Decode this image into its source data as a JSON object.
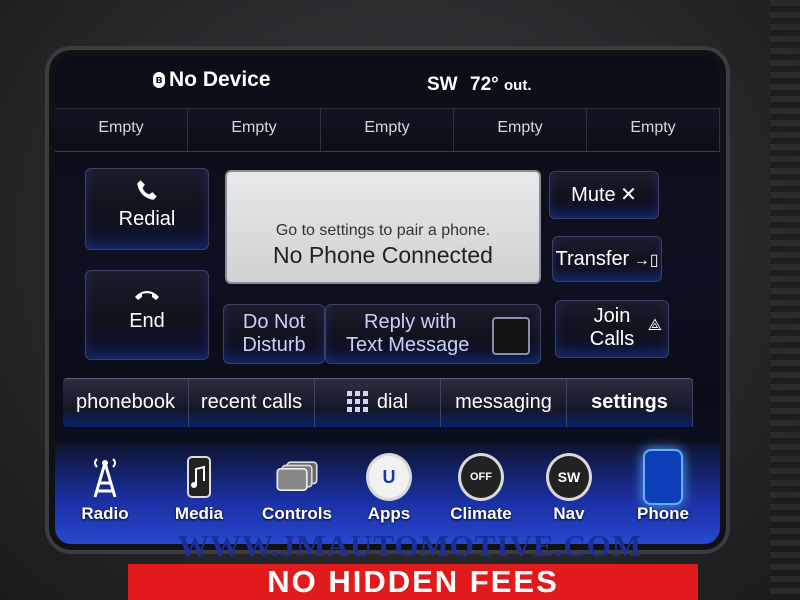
{
  "status": {
    "device": "No Device",
    "compass": "SW",
    "temp": "72°",
    "temp_suffix": "out."
  },
  "favorites": [
    "Empty",
    "Empty",
    "Empty",
    "Empty",
    "Empty"
  ],
  "phone": {
    "redial_label": "Redial",
    "end_label": "End",
    "mute_label": "Mute",
    "transfer_label": "Transfer",
    "join_line1": "Join",
    "join_line2": "Calls",
    "dnd_line1": "Do Not",
    "dnd_line2": "Disturb",
    "reply_line1": "Reply with",
    "reply_line2": "Text Message",
    "message_small": "Go to settings to pair a phone.",
    "message_big": "No Phone Connected"
  },
  "nav": {
    "phonebook": "phonebook",
    "recent": "recent calls",
    "dial": "dial",
    "messaging": "messaging",
    "settings": "settings"
  },
  "dock": {
    "radio": "Radio",
    "media": "Media",
    "controls": "Controls",
    "apps": "Apps",
    "climate": "Climate",
    "climate_badge": "OFF",
    "nav": "Nav",
    "nav_badge": "SW",
    "phone": "Phone"
  },
  "watermark": "WWW.JMAUTOMOTIVE.COM",
  "banner": "NO HIDDEN FEES",
  "colors": {
    "accent_blue": "#2748d0",
    "banner_red": "#e11b1b"
  }
}
